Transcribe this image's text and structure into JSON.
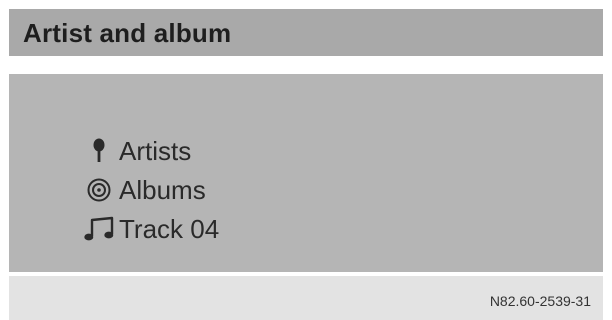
{
  "header": {
    "title": "Artist and album"
  },
  "menu": {
    "items": [
      {
        "icon": "microphone-icon",
        "label": "Artists"
      },
      {
        "icon": "disc-icon",
        "label": "Albums"
      },
      {
        "icon": "music-note-icon",
        "label": "Track 04"
      }
    ]
  },
  "footer": {
    "reference": "N82.60-2539-31"
  },
  "colors": {
    "title_bar": "#a9a9a9",
    "panel": "#b5b5b5",
    "footer": "#e3e3e3",
    "text": "#2a2a2a"
  }
}
